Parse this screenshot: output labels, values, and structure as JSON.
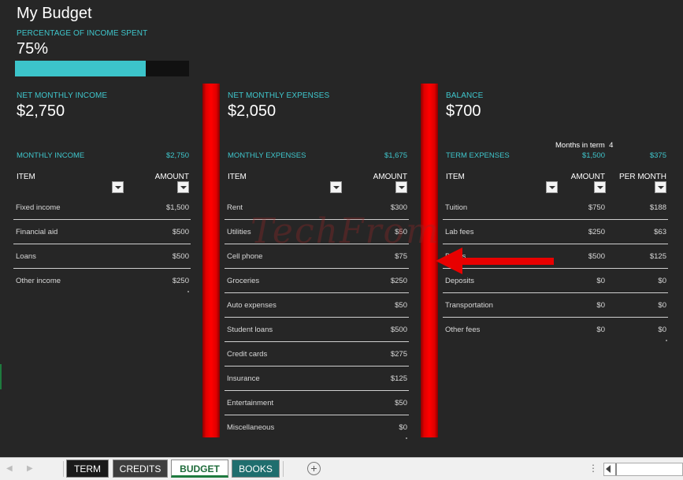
{
  "budget": {
    "title": "My Budget",
    "percentage_label": "PERCENTAGE OF INCOME SPENT",
    "percentage_value": "75%",
    "percentage_fraction": 0.75
  },
  "income": {
    "net_label": "NET MONTHLY INCOME",
    "net_value": "$2,750",
    "section_label": "MONTHLY INCOME",
    "section_total": "$2,750",
    "col_item": "ITEM",
    "col_amount": "AMOUNT",
    "rows": [
      {
        "item": "Fixed income",
        "amount": "$1,500"
      },
      {
        "item": "Financial aid",
        "amount": "$500"
      },
      {
        "item": "Loans",
        "amount": "$500"
      },
      {
        "item": "Other income",
        "amount": "$250"
      }
    ]
  },
  "expenses": {
    "net_label": "NET MONTHLY EXPENSES",
    "net_value": "$2,050",
    "section_label": "MONTHLY EXPENSES",
    "section_total": "$1,675",
    "col_item": "ITEM",
    "col_amount": "AMOUNT",
    "rows": [
      {
        "item": "Rent",
        "amount": "$300"
      },
      {
        "item": "Utilities",
        "amount": "$50"
      },
      {
        "item": "Cell phone",
        "amount": "$75"
      },
      {
        "item": "Groceries",
        "amount": "$250"
      },
      {
        "item": "Auto expenses",
        "amount": "$50"
      },
      {
        "item": "Student loans",
        "amount": "$500"
      },
      {
        "item": "Credit cards",
        "amount": "$275"
      },
      {
        "item": "Insurance",
        "amount": "$125"
      },
      {
        "item": "Entertainment",
        "amount": "$50"
      },
      {
        "item": "Miscellaneous",
        "amount": "$0"
      }
    ]
  },
  "term": {
    "balance_label": "BALANCE",
    "balance_value": "$700",
    "months_label": "Months in term",
    "months_value": "4",
    "section_label": "TERM EXPENSES",
    "section_total": "$1,500",
    "section_per_month": "$375",
    "col_item": "ITEM",
    "col_amount": "AMOUNT",
    "col_per_month": "PER MONTH",
    "rows": [
      {
        "item": "Tuition",
        "amount": "$750",
        "per_month": "$188"
      },
      {
        "item": "Lab fees",
        "amount": "$250",
        "per_month": "$63"
      },
      {
        "item": "Books",
        "amount": "$500",
        "per_month": "$125"
      },
      {
        "item": "Deposits",
        "amount": "$0",
        "per_month": "$0"
      },
      {
        "item": "Transportation",
        "amount": "$0",
        "per_month": "$0"
      },
      {
        "item": "Other fees",
        "amount": "$0",
        "per_month": "$0"
      }
    ]
  },
  "watermark": "TechFrom",
  "tabs": {
    "term": "TERM",
    "credits": "CREDITS",
    "budget": "BUDGET",
    "books": "BOOKS"
  },
  "colors": {
    "accent": "#3fc6cc",
    "background": "#262626",
    "annotation": "#ff0000"
  }
}
